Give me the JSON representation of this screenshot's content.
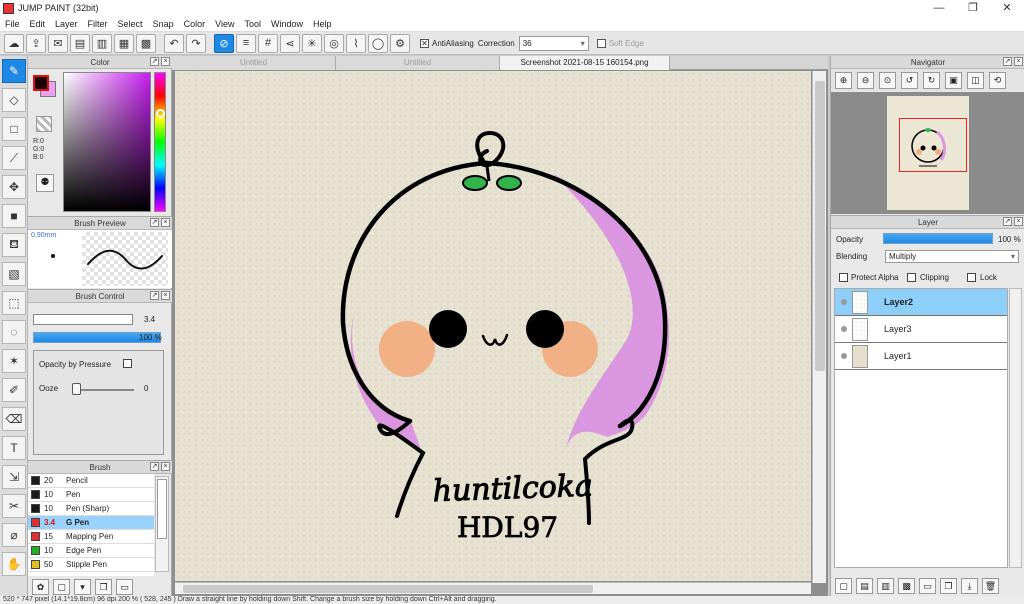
{
  "window": {
    "title": "JUMP PAINT (32bit)",
    "minimize": "—",
    "restore": "❐",
    "close": "✕"
  },
  "menu": [
    "File",
    "Edit",
    "Layer",
    "Filter",
    "Select",
    "Snap",
    "Color",
    "View",
    "Tool",
    "Window",
    "Help"
  ],
  "toolbar": {
    "antialiasing_label": "AntiAliasing",
    "antialiasing_checked": "✕",
    "correction_label": "Correction",
    "correction_value": "36",
    "soft_edge_label": "Soft Edge"
  },
  "color_panel": {
    "title": "Color",
    "r": "R:0",
    "g": "G:0",
    "b": "B:0",
    "foreground": "#1a0000",
    "background": "#e9a3ef"
  },
  "brush_preview": {
    "title": "Brush Preview",
    "size": "0.90mm"
  },
  "brush_control": {
    "title": "Brush Control",
    "size_value": "3.4",
    "opacity_value": "100 %",
    "opacity_by_pressure_label": "Opacity by Pressure",
    "ooze_label": "Ooze",
    "ooze_value": "0"
  },
  "brush_panel": {
    "title": "Brush",
    "items": [
      {
        "size": "20",
        "name": "Pencil",
        "color": "#1a1a1a"
      },
      {
        "size": "10",
        "name": "Pen",
        "color": "#1a1a1a"
      },
      {
        "size": "10",
        "name": "Pen (Sharp)",
        "color": "#1a1a1a"
      },
      {
        "size": "3.4",
        "name": "G Pen",
        "color": "#e03030"
      },
      {
        "size": "15",
        "name": "Mapping Pen",
        "color": "#e03030"
      },
      {
        "size": "10",
        "name": "Edge Pen",
        "color": "#20b020"
      },
      {
        "size": "50",
        "name": "Stipple Pen",
        "color": "#e0c020"
      }
    ]
  },
  "document_tabs": [
    "Untitled",
    "Untitled",
    "Screenshot 2021-08-15 160154.png"
  ],
  "canvas_art": {
    "signature": "huntilcoka",
    "signature2": "HDL97"
  },
  "navigator": {
    "title": "Navigator"
  },
  "layer_panel": {
    "title": "Layer",
    "opacity_label": "Opacity",
    "opacity_value": "100 %",
    "blending_label": "Blending",
    "blending_value": "Multiply",
    "protect_alpha_label": "Protect Alpha",
    "clipping_label": "Clipping",
    "lock_label": "Lock",
    "layers": [
      "Layer2",
      "Layer3",
      "Layer1"
    ]
  },
  "status": {
    "text": "520 * 747 pixel   (14.1*19.8cm)   96 dpi   200 %   ( 528, 245 )   Draw a straight line by holding down Shift. Change a brush size by holding down Ctrl+Alt and dragging."
  }
}
